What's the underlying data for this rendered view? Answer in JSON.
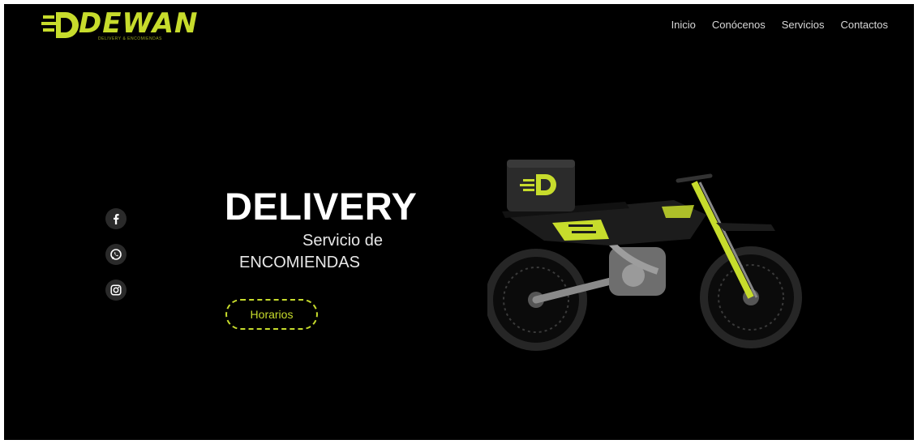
{
  "brand": {
    "name": "DEWAN",
    "tagline": "DELIVERY & ENCOMIENDAS",
    "accent": "#c7dc2c"
  },
  "nav": {
    "items": [
      {
        "label": "Inicio"
      },
      {
        "label": "Conócenos"
      },
      {
        "label": "Servicios"
      },
      {
        "label": "Contactos"
      }
    ]
  },
  "social": {
    "icons": [
      "facebook-icon",
      "whatsapp-icon",
      "instagram-icon"
    ]
  },
  "hero": {
    "title": "DELIVERY",
    "line1": "Servicio de",
    "line2": "ENCOMIENDAS",
    "button_label": "Horarios"
  },
  "colors": {
    "background": "#000000",
    "text": "#ffffff",
    "accent": "#c7dc2c"
  }
}
